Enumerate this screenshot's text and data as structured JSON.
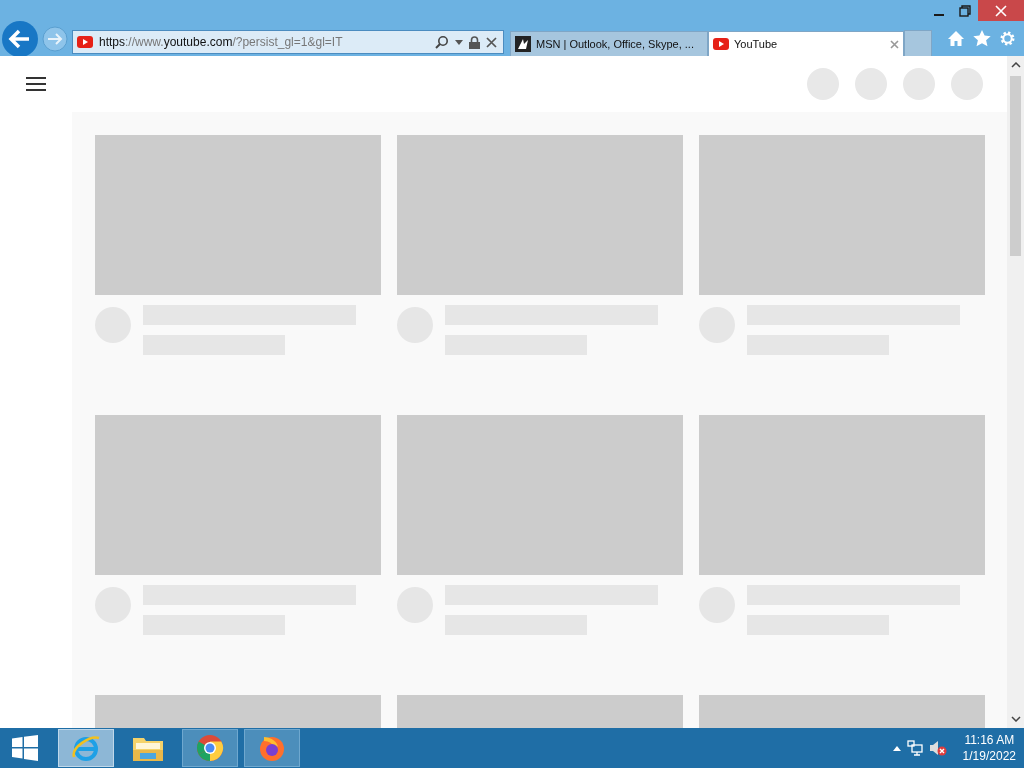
{
  "browser": {
    "url": {
      "scheme": "https",
      "separator": "://www.",
      "host": "youtube.com",
      "path": "/?persist_gl=1&gl=IT"
    },
    "tabs": [
      {
        "title": "MSN | Outlook, Office, Skype, ...",
        "kind": "msn",
        "selected": false
      },
      {
        "title": "YouTube",
        "kind": "youtube",
        "selected": true
      }
    ]
  },
  "page": {
    "header_buttons": [
      {
        "kind": "circle"
      },
      {
        "kind": "circle"
      },
      {
        "kind": "circle"
      },
      {
        "kind": "circle"
      }
    ],
    "video_cards": [
      {
        "kind": "skeleton"
      },
      {
        "kind": "skeleton"
      },
      {
        "kind": "skeleton"
      },
      {
        "kind": "skeleton"
      },
      {
        "kind": "skeleton"
      },
      {
        "kind": "skeleton"
      },
      {
        "kind": "thumbnail_only"
      },
      {
        "kind": "thumbnail_only"
      },
      {
        "kind": "thumbnail_only"
      }
    ]
  },
  "taskbar": {
    "apps": [
      {
        "kind": "ie",
        "selected": true
      },
      {
        "kind": "explorer",
        "selected": false
      },
      {
        "kind": "chrome",
        "selected": false
      },
      {
        "kind": "firefox",
        "selected": false
      }
    ],
    "clock": {
      "time": "11:16 AM",
      "date": "1/19/2022"
    }
  }
}
